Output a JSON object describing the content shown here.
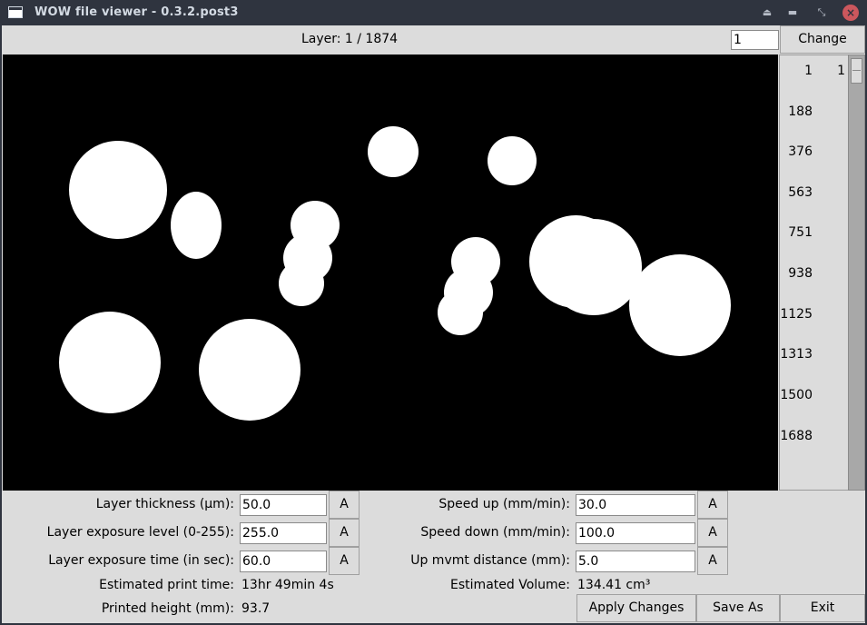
{
  "window": {
    "title": "WOW file viewer - 0.3.2.post3",
    "controls": [
      "eject-icon",
      "minimize-icon",
      "restore-icon",
      "close-icon"
    ]
  },
  "header": {
    "layer_label": "Layer: 1 / 1874",
    "layer_input": "1",
    "change_label": "Change"
  },
  "layer_list": {
    "ticks": [
      "1",
      "188",
      "376",
      "563",
      "751",
      "938",
      "1125",
      "1313",
      "1500",
      "1688"
    ],
    "current": "1"
  },
  "params_left": [
    {
      "label": "Layer thickness (µm):",
      "value": "50.0",
      "button": "A"
    },
    {
      "label": "Layer exposure level (0-255):",
      "value": "255.0",
      "button": "A"
    },
    {
      "label": "Layer exposure time (in sec):",
      "value": "60.0",
      "button": "A"
    }
  ],
  "params_right": [
    {
      "label": "Speed up (mm/min):",
      "value": "30.0",
      "button": "A"
    },
    {
      "label": "Speed down (mm/min):",
      "value": "100.0",
      "button": "A"
    },
    {
      "label": "Up mvmt distance (mm):",
      "value": "5.0",
      "button": "A"
    }
  ],
  "estimates": {
    "print_time_label": "Estimated print time:",
    "print_time_value": "13hr 49min 4s",
    "volume_label": "Estimated Volume:",
    "volume_value": "134.41 cm³",
    "height_label": "Printed height (mm):",
    "height_value": "93.7"
  },
  "buttons": {
    "apply": "Apply Changes",
    "save_as": "Save As",
    "exit": "Exit"
  },
  "colors": {
    "canvas_bg": "#000000",
    "shape_fill": "#ffffff",
    "window_bg": "#dcdcdc",
    "titlebar_bg": "#2f343f",
    "close_btn": "#cc575d"
  }
}
